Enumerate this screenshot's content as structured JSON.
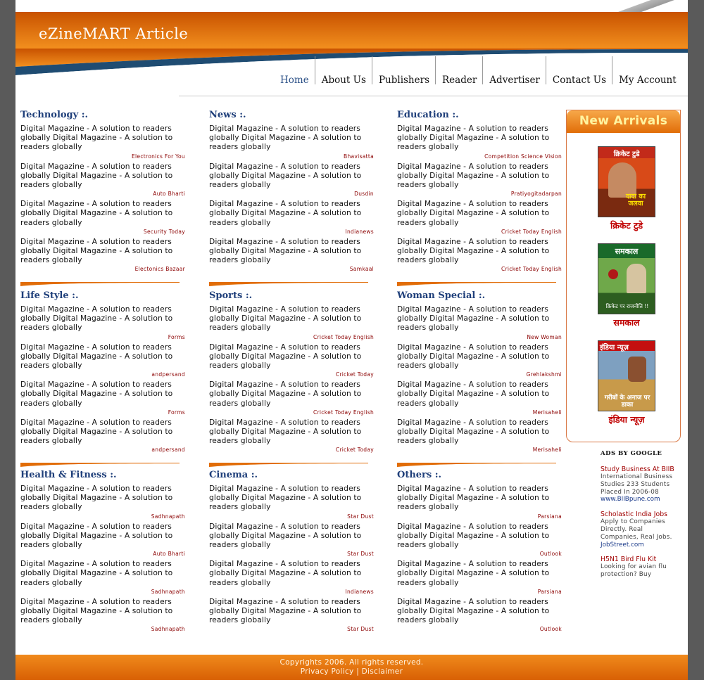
{
  "site": {
    "title": "eZineMART Article"
  },
  "nav": [
    {
      "label": "Home"
    },
    {
      "label": "About Us"
    },
    {
      "label": "Publishers"
    },
    {
      "label": "Reader"
    },
    {
      "label": "Advertiser"
    },
    {
      "label": "Contact Us"
    },
    {
      "label": "My Account"
    }
  ],
  "colors": {
    "orange": "#e16d08",
    "navy": "#1f3f7a",
    "source_red": "#8b0000"
  },
  "sections": [
    {
      "title": "Technology :.",
      "items": [
        {
          "text": "Digital Magazine - A solution to readers globally Digital Magazine - A solution to readers globally",
          "source": "Electronics For You"
        },
        {
          "text": "Digital Magazine - A solution to readers globally Digital Magazine - A solution to readers globally",
          "source": "Auto Bharti"
        },
        {
          "text": "Digital Magazine - A solution to readers globally Digital Magazine - A solution to readers globally",
          "source": "Security Today"
        },
        {
          "text": "Digital Magazine - A solution to readers globally Digital Magazine - A solution to readers globally",
          "source": "Electonics Bazaar"
        }
      ]
    },
    {
      "title": "News :.",
      "items": [
        {
          "text": "Digital Magazine - A solution to readers globally Digital Magazine - A solution to readers globally",
          "source": "Bhavisatta"
        },
        {
          "text": "Digital Magazine - A solution to readers globally Digital Magazine - A solution to readers globally",
          "source": "Dusdin"
        },
        {
          "text": "Digital Magazine - A solution to readers globally Digital Magazine - A solution to readers globally",
          "source": "Indianews"
        },
        {
          "text": "Digital Magazine - A solution to readers globally Digital Magazine - A solution to readers globally",
          "source": "Samkaal"
        }
      ]
    },
    {
      "title": "Education :.",
      "items": [
        {
          "text": "Digital Magazine - A solution to readers globally Digital Magazine - A solution to readers globally",
          "source": "Competition Science Vision"
        },
        {
          "text": "Digital Magazine - A solution to readers globally Digital Magazine - A solution to readers globally",
          "source": "Pratiyogitadarpan"
        },
        {
          "text": "Digital Magazine - A solution to readers globally Digital Magazine - A solution to readers globally",
          "source": "Cricket Today English"
        },
        {
          "text": "Digital Magazine - A solution to readers globally Digital Magazine - A solution to readers globally",
          "source": "Cricket Today English"
        }
      ]
    },
    {
      "title": "Life Style :.",
      "items": [
        {
          "text": "Digital Magazine - A solution to readers globally Digital Magazine - A solution to readers globally",
          "source": "Forms"
        },
        {
          "text": "Digital Magazine - A solution to readers globally Digital Magazine - A solution to readers globally",
          "source": "andpersand"
        },
        {
          "text": "Digital Magazine - A solution to readers globally Digital Magazine - A solution to readers globally",
          "source": "Forms"
        },
        {
          "text": "Digital Magazine - A solution to readers globally Digital Magazine - A solution to readers globally",
          "source": "andpersand"
        }
      ]
    },
    {
      "title": "Sports  :.",
      "items": [
        {
          "text": "Digital Magazine - A solution to readers globally Digital Magazine - A solution to readers globally",
          "source": "Cricket Today English"
        },
        {
          "text": "Digital Magazine - A solution to readers globally Digital Magazine - A solution to readers globally",
          "source": "Cricket Today"
        },
        {
          "text": "Digital Magazine - A solution to readers globally Digital Magazine - A solution to readers globally",
          "source": "Cricket Today English"
        },
        {
          "text": "Digital Magazine - A solution to readers globally Digital Magazine - A solution to readers globally",
          "source": "Cricket Today"
        }
      ]
    },
    {
      "title": "Woman Special :.",
      "items": [
        {
          "text": "Digital Magazine - A solution to readers globally Digital Magazine - A solution to readers globally",
          "source": "New Woman"
        },
        {
          "text": "Digital Magazine - A solution to readers globally Digital Magazine - A solution to readers globally",
          "source": "Grehlakshmi"
        },
        {
          "text": "Digital Magazine - A solution to readers globally Digital Magazine - A solution to readers globally",
          "source": "Merisaheli"
        },
        {
          "text": "Digital Magazine - A solution to readers globally Digital Magazine - A solution to readers globally",
          "source": "Merisaheli"
        }
      ]
    },
    {
      "title": "Health & Fitness :.",
      "items": [
        {
          "text": "Digital Magazine - A solution to readers globally Digital Magazine - A solution to readers globally",
          "source": "Sadhnapath"
        },
        {
          "text": "Digital Magazine - A solution to readers globally Digital Magazine - A solution to readers globally",
          "source": "Auto Bharti"
        },
        {
          "text": "Digital Magazine - A solution to readers globally Digital Magazine - A solution to readers globally",
          "source": "Sadhnapath"
        },
        {
          "text": "Digital Magazine - A solution to readers globally Digital Magazine - A solution to readers globally",
          "source": "Sadhnapath"
        }
      ]
    },
    {
      "title": "Cinema :.",
      "items": [
        {
          "text": "Digital Magazine - A solution to readers globally Digital Magazine - A solution to readers globally",
          "source": "Star Dust"
        },
        {
          "text": "Digital Magazine - A solution to readers globally Digital Magazine - A solution to readers globally",
          "source": "Star Dust"
        },
        {
          "text": "Digital Magazine - A solution to readers globally Digital Magazine - A solution to readers globally",
          "source": "Indianews"
        },
        {
          "text": "Digital Magazine - A solution to readers globally Digital Magazine - A solution to readers globally",
          "source": "Star Dust"
        }
      ]
    },
    {
      "title": "Others :.",
      "items": [
        {
          "text": "Digital Magazine - A solution to readers globally Digital Magazine - A solution to readers globally",
          "source": "Parsiana"
        },
        {
          "text": "Digital Magazine - A solution to readers globally Digital Magazine - A solution to readers globally",
          "source": "Outlook"
        },
        {
          "text": "Digital Magazine - A solution to readers globally Digital Magazine - A solution to readers globally",
          "source": "Parsiana"
        },
        {
          "text": "Digital Magazine - A solution to readers globally Digital Magazine - A solution to readers globally",
          "source": "Outlook"
        }
      ]
    }
  ],
  "new_arrivals": {
    "title": "New Arrivals",
    "magazines": [
      {
        "label": "क्रिकेट टुडे",
        "cover_title": "क्रिकेट टुडे",
        "cover_tag": "दादा का जलवा"
      },
      {
        "label": "समकाल",
        "cover_title": "समकाल",
        "cover_tag": "क्रिकेट पर राजनीति !!"
      },
      {
        "label": "इंडिया न्यूज़",
        "cover_title": "इंडिया न्यूज़",
        "cover_tag": "गरीबों के अनाज पर डाका"
      }
    ]
  },
  "ads": {
    "header": "ADS BY GOOGLE",
    "items": [
      {
        "title": "Study Business At BIIB",
        "body": "International Business Studies 233 Students Placed In 2006-08",
        "url": "www.BIIBpune.com"
      },
      {
        "title": "Scholastic India Jobs",
        "body": "Apply to Companies Directly. Real Companies, Real Jobs.",
        "url": "JobStreet.com"
      },
      {
        "title": "H5N1 Bird Flu Kit",
        "body": "Looking for avian flu protection? Buy",
        "url": ""
      }
    ]
  },
  "footer": {
    "copyright": "Copyrights 2006. All rights reserved.",
    "links": "Privacy Policy | Disclaimer"
  }
}
